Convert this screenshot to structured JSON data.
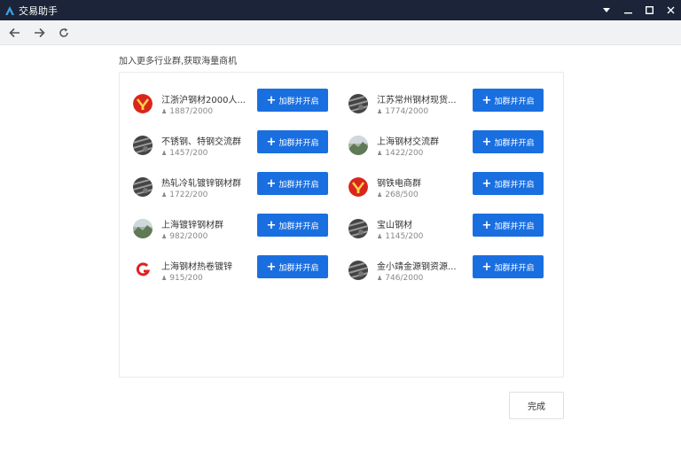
{
  "window": {
    "title": "交易助手",
    "accent": "#1a6fe0",
    "titlebar_bg": "#1b2438"
  },
  "nav": {
    "icons": [
      "back-arrow-icon",
      "forward-arrow-icon",
      "refresh-icon"
    ]
  },
  "heading": "加入更多行业群,获取海量商机",
  "groups": [
    {
      "name": "江浙沪钢材2000人...",
      "count": "1887/2000",
      "avatar": "red-logo-icon"
    },
    {
      "name": "江苏常州钢材现货...",
      "count": "1774/2000",
      "avatar": "steel-photo-icon"
    },
    {
      "name": "不锈钢、特钢交流群",
      "count": "1457/200",
      "avatar": "steel-photo-icon"
    },
    {
      "name": "上海钢材交流群",
      "count": "1422/200",
      "avatar": "landscape-photo-icon"
    },
    {
      "name": "热轧冷轧镀锌钢材群",
      "count": "1722/200",
      "avatar": "steel-photo-icon"
    },
    {
      "name": "钢铁电商群",
      "count": "268/500",
      "avatar": "red-logo-icon"
    },
    {
      "name": "上海镀锌钢材群",
      "count": "982/2000",
      "avatar": "landscape-photo-icon"
    },
    {
      "name": "宝山钢材",
      "count": "1145/200",
      "avatar": "steel-photo-icon"
    },
    {
      "name": "上海钢材热卷镀锌",
      "count": "915/200",
      "avatar": "red-g-logo-icon"
    },
    {
      "name": "金小靖金源钢资源...",
      "count": "746/2000",
      "avatar": "steel-photo-icon"
    }
  ],
  "join_label": "加群并开启",
  "done_label": "完成"
}
